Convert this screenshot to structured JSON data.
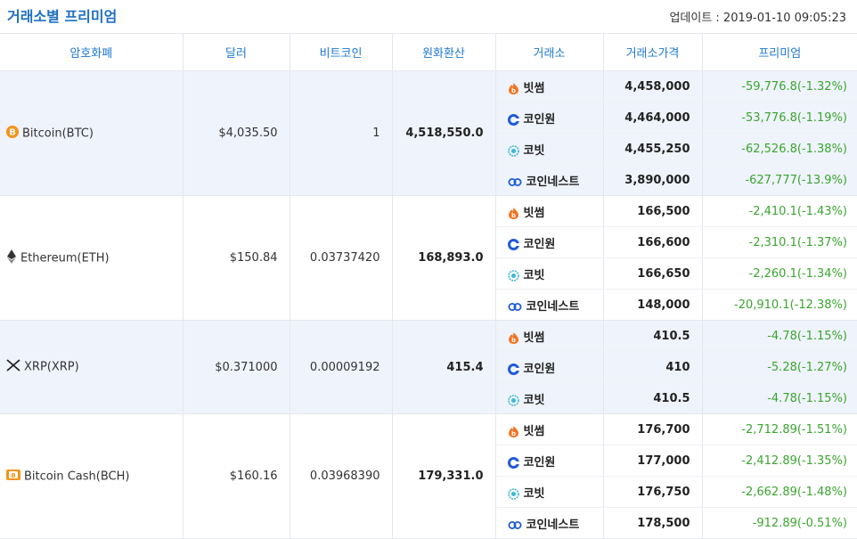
{
  "header": {
    "title": "거래소별 프리미엄",
    "updated_label": "업데이트 : 2019-01-10 09:05:23"
  },
  "columns": {
    "coin": "암호화폐",
    "dollar": "달러",
    "btc": "비트코인",
    "krw": "원화환산",
    "exchange": "거래소",
    "price": "거래소가격",
    "premium": "프리미엄"
  },
  "coins": [
    {
      "name": "Bitcoin(BTC)",
      "icon": "bitcoin-icon",
      "dollar": "$4,035.50",
      "btc": "1",
      "krw": "4,518,550.0",
      "rows": [
        {
          "exchange": "빗썸",
          "icon": "bithumb-icon",
          "price": "4,458,000",
          "premium": "-59,776.8(-1.32%)"
        },
        {
          "exchange": "코인원",
          "icon": "coinone-icon",
          "price": "4,464,000",
          "premium": "-53,776.8(-1.19%)"
        },
        {
          "exchange": "코빗",
          "icon": "korbit-icon",
          "price": "4,455,250",
          "premium": "-62,526.8(-1.38%)"
        },
        {
          "exchange": "코인네스트",
          "icon": "coinnest-icon",
          "price": "3,890,000",
          "premium": "-627,777(-13.9%)"
        }
      ]
    },
    {
      "name": "Ethereum(ETH)",
      "icon": "ethereum-icon",
      "dollar": "$150.84",
      "btc": "0.03737420",
      "krw": "168,893.0",
      "rows": [
        {
          "exchange": "빗썸",
          "icon": "bithumb-icon",
          "price": "166,500",
          "premium": "-2,410.1(-1.43%)"
        },
        {
          "exchange": "코인원",
          "icon": "coinone-icon",
          "price": "166,600",
          "premium": "-2,310.1(-1.37%)"
        },
        {
          "exchange": "코빗",
          "icon": "korbit-icon",
          "price": "166,650",
          "premium": "-2,260.1(-1.34%)"
        },
        {
          "exchange": "코인네스트",
          "icon": "coinnest-icon",
          "price": "148,000",
          "premium": "-20,910.1(-12.38%)"
        }
      ]
    },
    {
      "name": "XRP(XRP)",
      "icon": "xrp-icon",
      "dollar": "$0.371000",
      "btc": "0.00009192",
      "krw": "415.4",
      "rows": [
        {
          "exchange": "빗썸",
          "icon": "bithumb-icon",
          "price": "410.5",
          "premium": "-4.78(-1.15%)"
        },
        {
          "exchange": "코인원",
          "icon": "coinone-icon",
          "price": "410",
          "premium": "-5.28(-1.27%)"
        },
        {
          "exchange": "코빗",
          "icon": "korbit-icon",
          "price": "410.5",
          "premium": "-4.78(-1.15%)"
        }
      ]
    },
    {
      "name": "Bitcoin Cash(BCH)",
      "icon": "bitcoin-cash-icon",
      "dollar": "$160.16",
      "btc": "0.03968390",
      "krw": "179,331.0",
      "rows": [
        {
          "exchange": "빗썸",
          "icon": "bithumb-icon",
          "price": "176,700",
          "premium": "-2,712.89(-1.51%)"
        },
        {
          "exchange": "코인원",
          "icon": "coinone-icon",
          "price": "177,000",
          "premium": "-2,412.89(-1.35%)"
        },
        {
          "exchange": "코빗",
          "icon": "korbit-icon",
          "price": "176,750",
          "premium": "-2,662.89(-1.48%)"
        },
        {
          "exchange": "코인네스트",
          "icon": "coinnest-icon",
          "price": "178,500",
          "premium": "-912.89(-0.51%)"
        }
      ]
    }
  ],
  "colors": {
    "title": "#1e6fc4",
    "header_text": "#1e78d2",
    "premium_green": "#3aa52f",
    "shaded_row": "#eff3fb"
  }
}
